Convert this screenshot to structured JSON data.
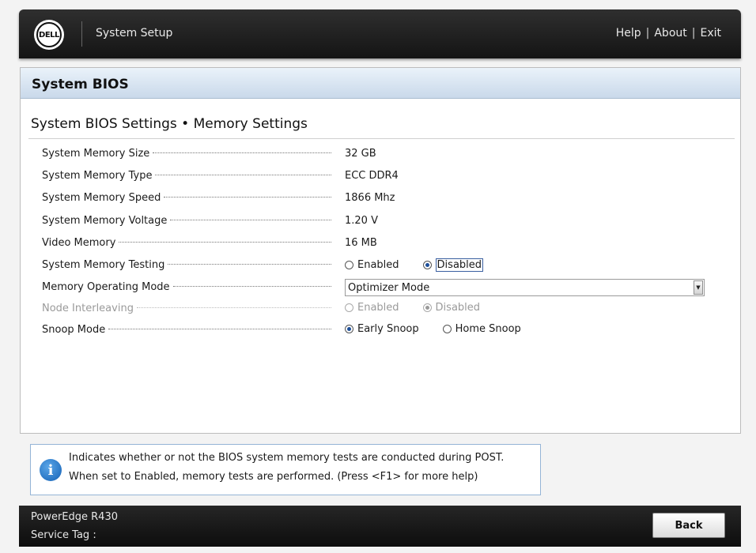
{
  "header": {
    "logo_text": "DELL",
    "app_title": "System Setup",
    "links": [
      "Help",
      "About",
      "Exit"
    ],
    "separator": "|"
  },
  "panel": {
    "title": "System BIOS",
    "section_title": "System BIOS Settings • Memory Settings"
  },
  "settings": {
    "memory_size": {
      "label": "System Memory Size",
      "value": "32 GB"
    },
    "memory_type": {
      "label": "System Memory Type",
      "value": "ECC DDR4"
    },
    "memory_speed": {
      "label": "System Memory Speed",
      "value": "1866 Mhz"
    },
    "memory_voltage": {
      "label": "System Memory Voltage",
      "value": "1.20 V"
    },
    "video_memory": {
      "label": "Video Memory",
      "value": "16 MB"
    },
    "memory_testing": {
      "label": "System Memory Testing",
      "options": [
        "Enabled",
        "Disabled"
      ],
      "selected": "Disabled"
    },
    "operating_mode": {
      "label": "Memory Operating Mode",
      "value": "Optimizer Mode"
    },
    "node_interleaving": {
      "label": "Node Interleaving",
      "options": [
        "Enabled",
        "Disabled"
      ],
      "selected": "Disabled",
      "disabled": true
    },
    "snoop_mode": {
      "label": "Snoop Mode",
      "options": [
        "Early Snoop",
        "Home Snoop"
      ],
      "selected": "Early Snoop"
    }
  },
  "help": {
    "line1": "Indicates whether or not the BIOS system memory tests are conducted during POST.",
    "line2": "When set to Enabled, memory tests are performed. (Press <F1> for more help)"
  },
  "footer": {
    "model": "PowerEdge R430",
    "service_tag_label": "Service Tag :",
    "back_label": "Back"
  },
  "colors": {
    "header_bg": "#1c1c1c",
    "panel_head": "#d6e3f0",
    "radio_selected": "#1d4f9a",
    "info_icon": "#1f6fc0"
  }
}
